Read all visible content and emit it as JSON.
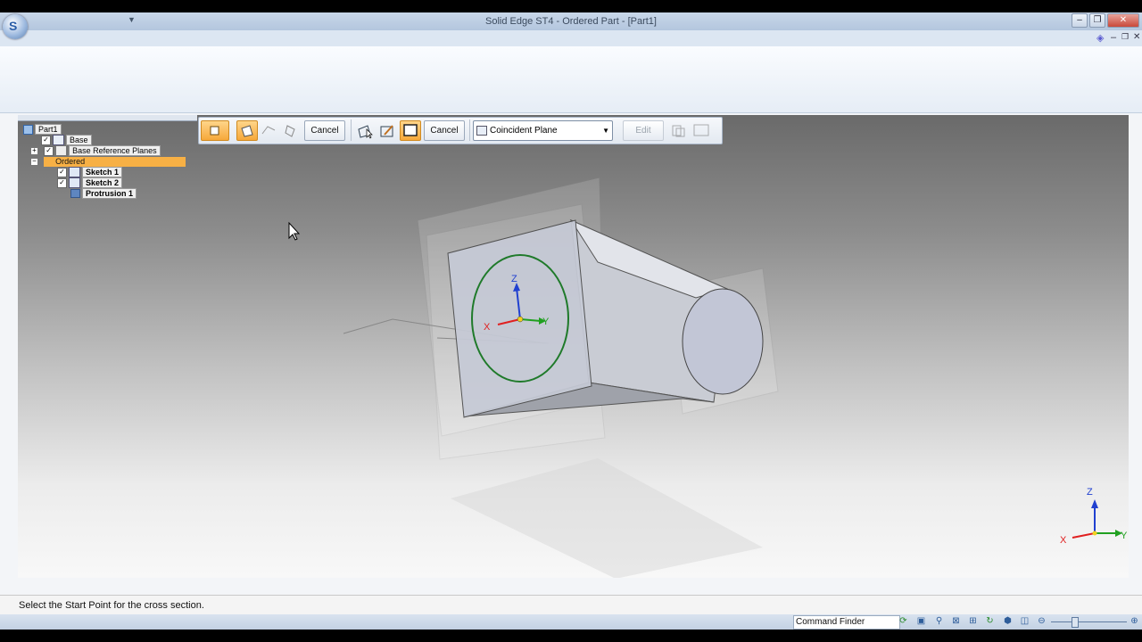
{
  "window": {
    "title": "Solid Edge ST4 - Ordered Part - [Part1]",
    "controls": {
      "minimize": "‒",
      "restore": "❐",
      "close": "✕"
    },
    "ribbon_controls": {
      "help": "◈",
      "minimize": "‒",
      "restore": "❐",
      "close": "✕"
    }
  },
  "pathfinder": {
    "root": "Part1",
    "items": [
      {
        "label": "Base",
        "checked": true,
        "expander": ""
      },
      {
        "label": "Base Reference Planes",
        "checked": true,
        "expander": "+"
      },
      {
        "label": "Ordered",
        "expander": "−",
        "selected": true
      },
      {
        "label": "Sketch 1",
        "checked": true
      },
      {
        "label": "Sketch 2",
        "checked": true
      },
      {
        "label": "Protrusion 1"
      }
    ]
  },
  "command_bar": {
    "cancel1": "Cancel",
    "cancel2": "Cancel",
    "plane_select": "Coincident Plane",
    "edit": "Edit"
  },
  "triad": {
    "x": "X",
    "y": "Y",
    "z": "Z"
  },
  "status": {
    "prompt": "Select the Start Point for the cross section.",
    "command_finder": "Command Finder"
  },
  "colors": {
    "selected_row": "#f7b045",
    "sketch_circle": "#1f7a2a",
    "axis_x": "#e02020",
    "axis_y": "#20a020",
    "axis_z": "#2040d0"
  },
  "icons": [
    "app-orb-icon",
    "check-icon",
    "expand-icon",
    "collapse-icon",
    "sketch-icon",
    "protrusion-icon",
    "reference-planes-icon",
    "part-icon",
    "dropdown-arrow-icon",
    "cursor-icon"
  ]
}
